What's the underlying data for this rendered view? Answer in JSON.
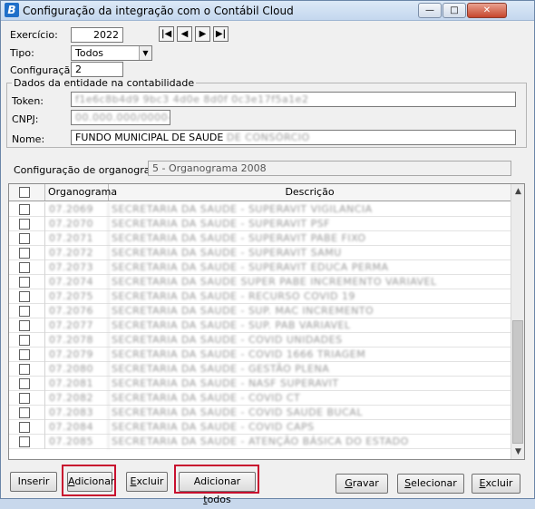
{
  "window": {
    "title": "Configuração da integração com o Contábil Cloud",
    "app_icon": "B"
  },
  "controls": {
    "min": "—",
    "max": "□",
    "close": "✕"
  },
  "form": {
    "exercicio_label": "Exercício:",
    "exercicio_value": "2022",
    "tipo_label": "Tipo:",
    "tipo_value": "Todos",
    "configuracao_label": "Configuração:",
    "configuracao_value": "2"
  },
  "nav": {
    "first": "|◀",
    "prev": "◀",
    "next": "▶",
    "last": "▶|"
  },
  "entity": {
    "group_title": "Dados da entidade na contabilidade",
    "token_label": "Token:",
    "token_value": "f1e6c8b4d9 9bc3 4d0e 8d0f 0c3e17f5a1e2",
    "cnpj_label": "CNPJ:",
    "cnpj_value": "00.000.000/0000-00",
    "nome_label": "Nome:",
    "nome_value": "FUNDO MUNICIPAL DE SAUDE",
    "nome_suffix": "DE CONSÓRCIO"
  },
  "organograma": {
    "label": "Configuração de organograma:",
    "value": "5 - Organograma 2008"
  },
  "table": {
    "headers": [
      "",
      "Organograma",
      "Descrição"
    ],
    "rows": [
      {
        "code": "07.2069",
        "desc": "SECRETARIA DA SAUDE - SUPERAVIT VIGILANCIA"
      },
      {
        "code": "07.2070",
        "desc": "SECRETARIA DA SAUDE - SUPERAVIT PSF"
      },
      {
        "code": "07.2071",
        "desc": "SECRETARIA DA SAUDE - SUPERAVIT PABE FIXO"
      },
      {
        "code": "07.2072",
        "desc": "SECRETARIA DA SAUDE - SUPERAVIT SAMU"
      },
      {
        "code": "07.2073",
        "desc": "SECRETARIA DA SAUDE - SUPERAVIT EDUCA PERMA"
      },
      {
        "code": "07.2074",
        "desc": "SECRETARIA DA SAUDE SUPER PABE INCREMENTO VARIAVEL"
      },
      {
        "code": "07.2075",
        "desc": "SECRETARIA DA SAUDE - RECURSO COVID 19"
      },
      {
        "code": "07.2076",
        "desc": "SECRETARIA DA SAUDE - SUP. MAC INCREMENTO"
      },
      {
        "code": "07.2077",
        "desc": "SECRETARIA DA SAUDE - SUP. PAB VARIAVEL"
      },
      {
        "code": "07.2078",
        "desc": "SECRETARIA DA SAUDE - COVID UNIDADES"
      },
      {
        "code": "07.2079",
        "desc": "SECRETARIA DA SAUDE - COVID 1666 TRIAGEM"
      },
      {
        "code": "07.2080",
        "desc": "SECRETARIA DA SAUDE - GESTÃO PLENA"
      },
      {
        "code": "07.2081",
        "desc": "SECRETARIA DA SAUDE - NASF SUPERAVIT"
      },
      {
        "code": "07.2082",
        "desc": "SECRETARIA DA SAUDE - COVID CT"
      },
      {
        "code": "07.2083",
        "desc": "SECRETARIA DA SAUDE - COVID SAUDE BUCAL"
      },
      {
        "code": "07.2084",
        "desc": "SECRETARIA DA SAUDE - COVID CAPS"
      },
      {
        "code": "07.2085",
        "desc": "SECRETARIA DA SAUDE - ATENÇÃO BÁSICA DO ESTADO"
      }
    ]
  },
  "buttons": {
    "inserir": "Inserir",
    "adicionar": "Adicionar",
    "excluir": "Excluir",
    "adicionar_todos": "Adicionar todos",
    "gravar": "Gravar",
    "selecionar": "Selecionar",
    "excluir2": "Excluir"
  },
  "colors": {
    "highlight": "#c8102e",
    "title_bar": "#c4d7ee",
    "app_icon": "#1f6fc9"
  }
}
